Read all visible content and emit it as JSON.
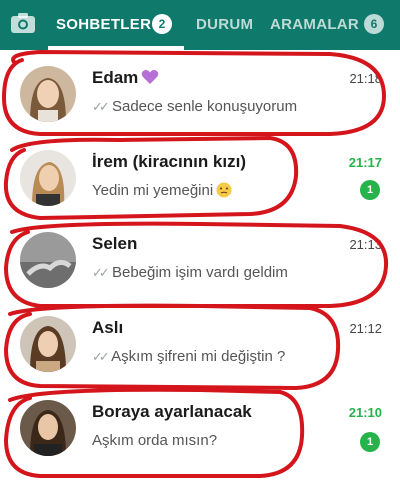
{
  "header": {
    "tabs": [
      {
        "label": "SOHBETLER",
        "badge": "2",
        "active": true
      },
      {
        "label": "DURUM",
        "badge": "",
        "active": false
      },
      {
        "label": "ARAMALAR",
        "badge": "6",
        "active": false
      }
    ],
    "camera_icon": "camera-icon",
    "color": "#0f7a6b"
  },
  "chats": [
    {
      "name": "Edam",
      "name_emoji": "purple-heart-icon",
      "message": "Sadece senle konuşuyorum",
      "read_ticks": true,
      "time": "21:18",
      "unread": ""
    },
    {
      "name": "İrem (kiracının kızı)",
      "message": "Yedin mi yemeğini",
      "message_emoji": "blushing-face-icon",
      "read_ticks": false,
      "time": "21:17",
      "unread": "1"
    },
    {
      "name": "Selen",
      "message": "Bebeğim işim vardı geldim",
      "read_ticks": true,
      "time": "21:13",
      "unread": ""
    },
    {
      "name": "Aslı",
      "message": "Aşkım şifreni mi değiştin ?",
      "read_ticks": true,
      "time": "21:12",
      "unread": ""
    },
    {
      "name": "Boraya ayarlanacak",
      "message": "Aşkım orda mısın?",
      "read_ticks": false,
      "time": "21:10",
      "unread": "1"
    }
  ],
  "accent_unread": "#27b34b",
  "annotation_color": "#d4161c"
}
